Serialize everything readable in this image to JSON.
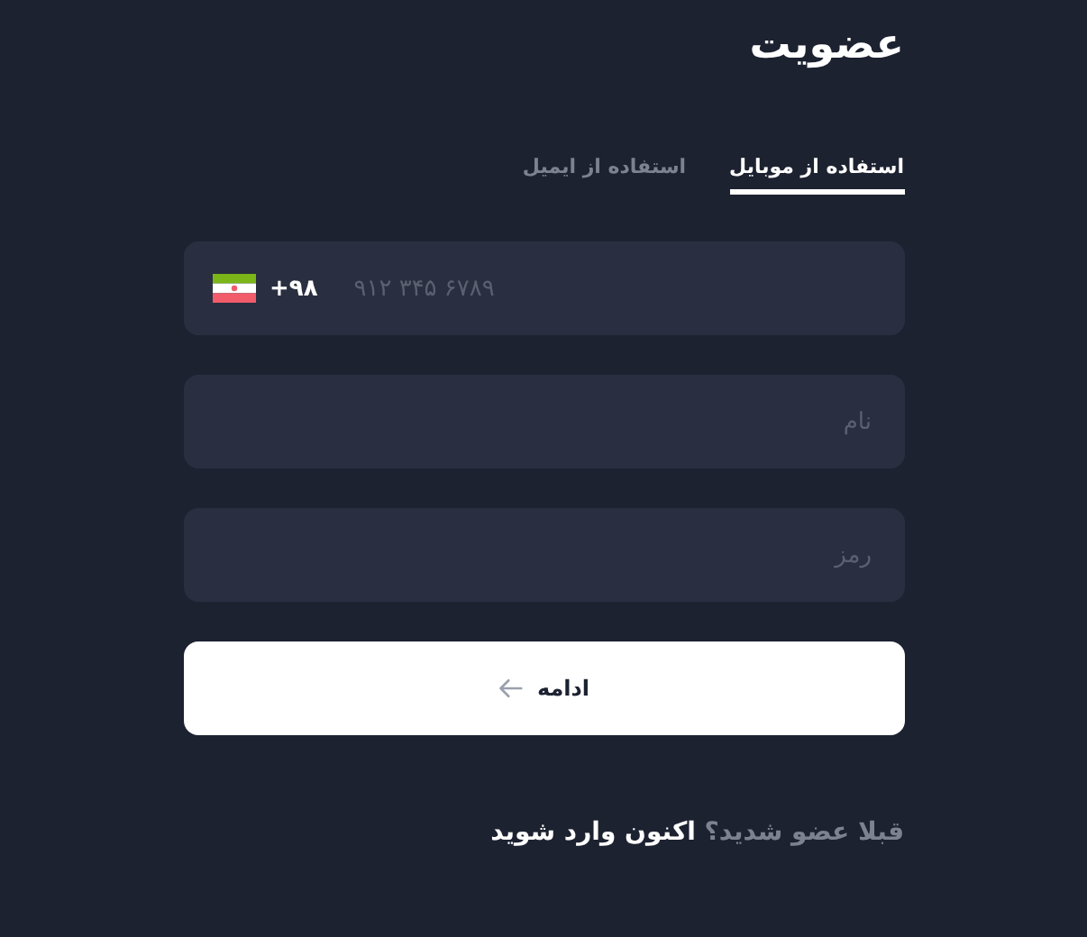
{
  "title": "عضویت",
  "tabs": [
    {
      "label": "استفاده از موبایل",
      "selected": true
    },
    {
      "label": "استفاده از ایمیل",
      "selected": false
    }
  ],
  "phone": {
    "country_code": "+۹۸",
    "placeholder": "۹۱۲ ۳۴۵ ۶۷۸۹"
  },
  "fields": [
    {
      "placeholder": "نام"
    },
    {
      "placeholder": "رمز"
    }
  ],
  "submit": {
    "label": "ادامه"
  },
  "footer": {
    "question": "قبلا عضو شدید؟",
    "link": "اکنون وارد شوید"
  }
}
